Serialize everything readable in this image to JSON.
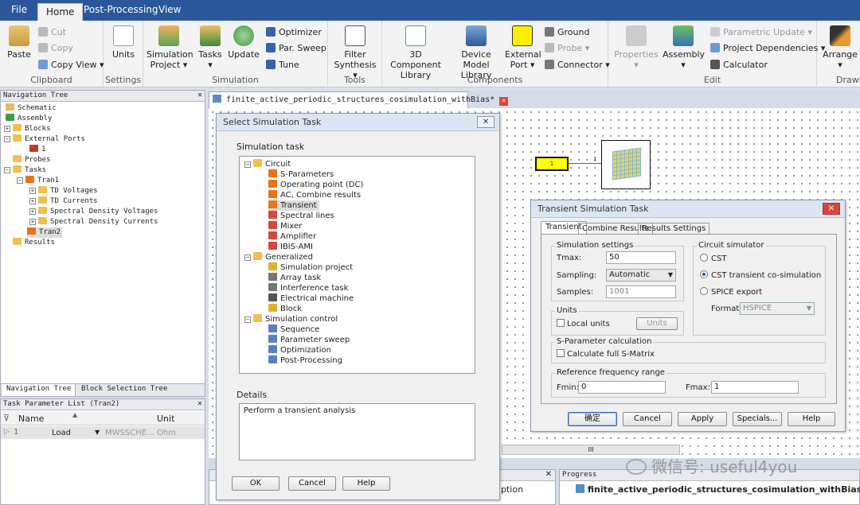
{
  "menu": {
    "file": "File",
    "home": "Home",
    "post": "Post-Processing",
    "view": "View"
  },
  "ribbon": {
    "clipboard": {
      "label": "Clipboard",
      "paste": "Paste",
      "cut": "Cut",
      "copy": "Copy",
      "copy_view": "Copy View"
    },
    "settings": {
      "label": "Settings",
      "units": "Units"
    },
    "simulation": {
      "label": "Simulation",
      "sim_project": "Simulation",
      "sim_project2": "Project",
      "tasks": "Tasks",
      "update": "Update",
      "optimizer": "Optimizer",
      "par_sweep": "Par. Sweep",
      "tune": "Tune"
    },
    "tools": {
      "label": "Tools",
      "filter": "Filter",
      "filter2": "Synthesis"
    },
    "components": {
      "label": "Components",
      "comp3d": "3D Component",
      "comp3d2": "Library",
      "device": "Device Model",
      "device2": "Library",
      "ext_port": "External",
      "ext_port2": "Port",
      "ground": "Ground",
      "probe": "Probe",
      "connector": "Connector"
    },
    "edit": {
      "label": "Edit",
      "properties": "Properties",
      "assembly": "Assembly",
      "param_update": "Parametric Update",
      "proj_dep": "Project Dependencies",
      "calculator": "Calculator"
    },
    "drawing": {
      "arrange": "Arrange",
      "label": "Drawi"
    }
  },
  "nav_tree": {
    "title": "Navigation Tree",
    "items": [
      "Schematic",
      "Assembly",
      "Blocks",
      "External Ports",
      "1",
      "Probes",
      "Tasks",
      "Tran1",
      "TD Voltages",
      "TD Currents",
      "Spectral Density Voltages",
      "Spectral Density Currents",
      "Tran2",
      "Results"
    ],
    "tab1": "Navigation Tree",
    "tab2": "Block Selection Tree"
  },
  "task_params": {
    "title": "Task Parameter List (Tran2)",
    "col_name": "Name",
    "col_unit": "Unit",
    "row": {
      "index": "1",
      "name": "Load",
      "value": "MWSSCHE...",
      "unit": "Ohm"
    }
  },
  "doc_tab": {
    "title": "finite_active_periodic_structures_cosimulation_withBias*"
  },
  "canvas": {
    "port_label": "1",
    "wire_label": "1"
  },
  "select_dialog": {
    "title": "Select Simulation Task",
    "group_task": "Simulation task",
    "tree": [
      "Circuit",
      "S-Parameters",
      "Operating point (DC)",
      "AC, Combine results",
      "Transient",
      "Spectral lines",
      "Mixer",
      "Amplifier",
      "IBIS-AMI",
      "Generalized",
      "Simulation project",
      "Array task",
      "Interference task",
      "Electrical machine",
      "Block",
      "Simulation control",
      "Sequence",
      "Parameter sweep",
      "Optimization",
      "Post-Processing"
    ],
    "group_details": "Details",
    "details_text": "Perform a transient analysis",
    "ok": "OK",
    "cancel": "Cancel",
    "help": "Help"
  },
  "transient_dialog": {
    "title": "Transient Simulation Task",
    "tabs": [
      "Transient",
      "Combine Results",
      "Results Settings"
    ],
    "sim_settings": "Simulation settings",
    "tmax_label": "Tmax:",
    "tmax_value": "50",
    "sampling_label": "Sampling:",
    "sampling_value": "Automatic",
    "samples_label": "Samples:",
    "samples_value": "1001",
    "units_group": "Units",
    "local_units": "Local units",
    "units_btn": "Units",
    "circuit_sim": "Circuit simulator",
    "opt_cst": "CST",
    "opt_cosim": "CST transient co-simulation",
    "opt_spice": "SPICE export",
    "format_label": "Format",
    "format_value": "HSPICE",
    "sparam_group": "S-Parameter calculation",
    "calc_smatrix": "Calculate full S-Matrix",
    "ref_freq": "Reference frequency range",
    "fmin_label": "Fmin:",
    "fmin_value": "0",
    "fmax_label": "Fmax:",
    "fmax_value": "1",
    "btn_ok": "确定",
    "btn_cancel": "Cancel",
    "btn_apply": "Apply",
    "btn_specials": "Specials...",
    "btn_help": "Help"
  },
  "bottom": {
    "option": "ption",
    "progress_title": "Progress",
    "progress_item": "finite_active_periodic_structures_cosimulation_withBias.cst",
    "scroll_label": "III"
  },
  "watermark": "微信号: useful4you",
  "colors": {
    "menubar": "#2b579a",
    "accent": "#1e5fb5",
    "port_fill": "#ffff00"
  }
}
